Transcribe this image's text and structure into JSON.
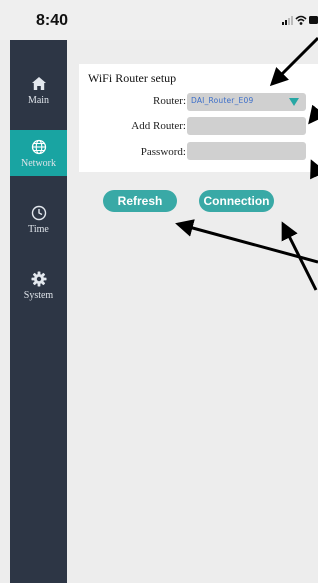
{
  "status_bar": {
    "time": "8:40"
  },
  "sidebar": {
    "items": [
      {
        "label": "Main",
        "icon": "home-icon",
        "active": false
      },
      {
        "label": "Network",
        "icon": "globe-icon",
        "active": true
      },
      {
        "label": "Time",
        "icon": "clock-icon",
        "active": false
      },
      {
        "label": "System",
        "icon": "gear-icon",
        "active": false
      }
    ]
  },
  "panel": {
    "title": "WiFi Router setup",
    "router_label": "Router:",
    "router_value": "DAI_Router_E09",
    "add_router_label": "Add Router:",
    "add_router_value": "",
    "password_label": "Password:",
    "password_value": ""
  },
  "buttons": {
    "refresh": "Refresh",
    "connection": "Connection"
  },
  "colors": {
    "sidebar_bg": "#2d3645",
    "accent": "#19a4a2",
    "button": "#39a9a6",
    "field_bg": "#d0d0d0",
    "select_text": "#3d6fc9",
    "annotation_arrow": "#000000"
  }
}
